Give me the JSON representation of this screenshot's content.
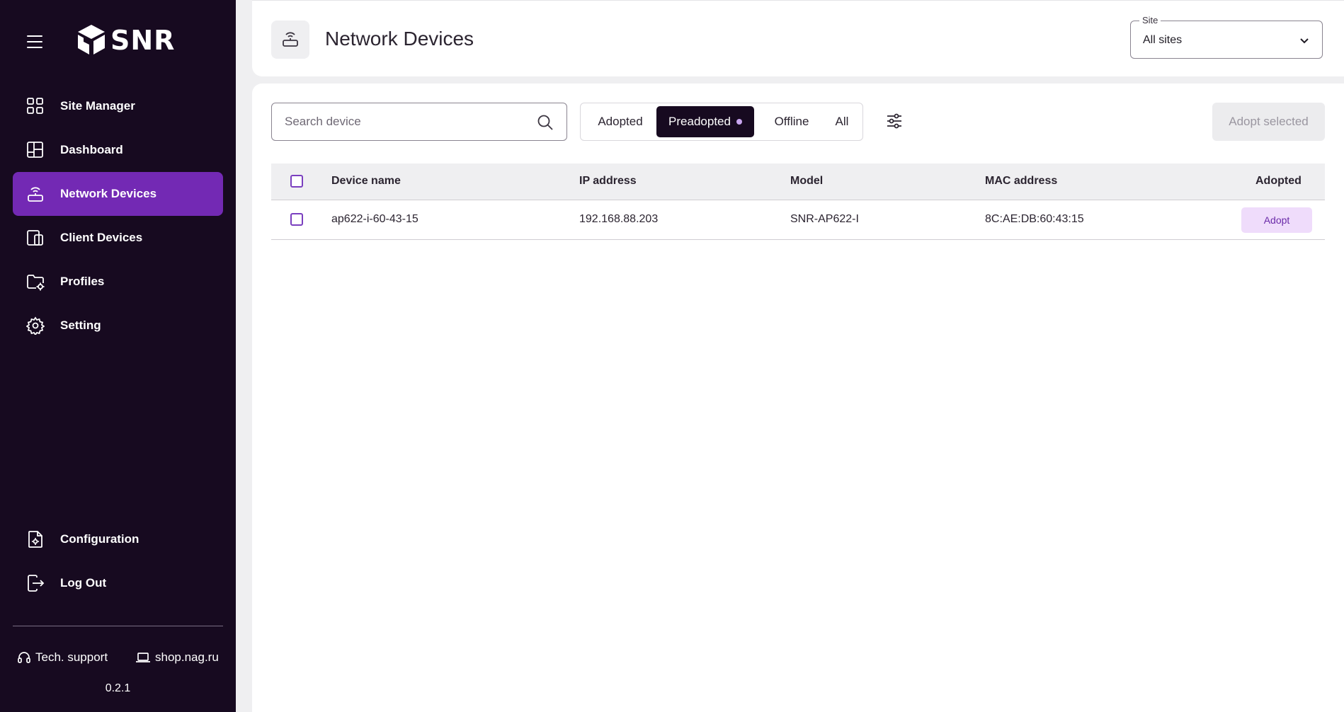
{
  "app": {
    "brand": "SNR",
    "version": "0.2.1"
  },
  "sidebar": {
    "items": [
      {
        "label": "Site Manager",
        "icon": "grid-icon"
      },
      {
        "label": "Dashboard",
        "icon": "dashboard-icon"
      },
      {
        "label": "Network Devices",
        "icon": "router-icon",
        "active": true
      },
      {
        "label": "Client Devices",
        "icon": "devices-icon"
      },
      {
        "label": "Profiles",
        "icon": "folder-gear-icon"
      },
      {
        "label": "Setting",
        "icon": "gear-icon"
      }
    ],
    "bottom_items": [
      {
        "label": "Configuration",
        "icon": "file-gear-icon"
      },
      {
        "label": "Log Out",
        "icon": "logout-icon"
      }
    ],
    "footer": {
      "support": "Tech. support",
      "shop": "shop.nag.ru"
    }
  },
  "header": {
    "title": "Network Devices",
    "site_select": {
      "label": "Site",
      "value": "All sites"
    }
  },
  "toolbar": {
    "search_placeholder": "Search device",
    "filters": [
      "Adopted",
      "Preadopted",
      "Offline",
      "All"
    ],
    "active_filter": "Preadopted",
    "adopt_selected": "Adopt selected"
  },
  "table": {
    "columns": [
      "Device name",
      "IP address",
      "Model",
      "MAC address",
      "Adopted"
    ],
    "rows": [
      {
        "name": "ap622-i-60-43-15",
        "ip": "192.168.88.203",
        "model": "SNR-AP622-I",
        "mac": "8C:AE:DB:60:43:15",
        "action": "Adopt"
      }
    ]
  },
  "colors": {
    "sidebar_bg": "#170a20",
    "accent": "#7329b4",
    "active_filter_bg": "#170a20"
  }
}
